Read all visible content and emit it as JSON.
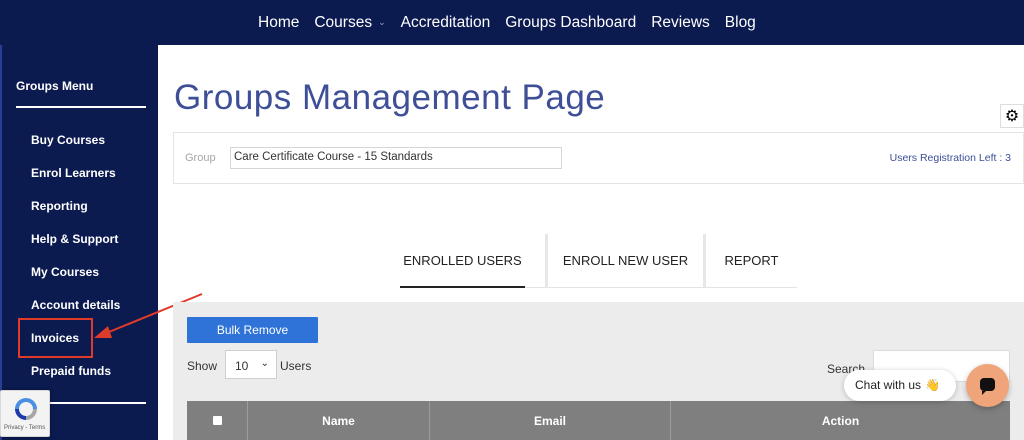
{
  "topnav": {
    "items": [
      {
        "label": "Home"
      },
      {
        "label": "Courses",
        "has_dropdown": true
      },
      {
        "label": "Accreditation"
      },
      {
        "label": "Groups Dashboard"
      },
      {
        "label": "Reviews"
      },
      {
        "label": "Blog"
      }
    ],
    "caret": "⌄"
  },
  "sidebar": {
    "title": "Groups Menu",
    "items": [
      {
        "label": "Buy Courses"
      },
      {
        "label": "Enrol Learners"
      },
      {
        "label": "Reporting"
      },
      {
        "label": "Help & Support"
      },
      {
        "label": "My Courses"
      },
      {
        "label": "Account details"
      },
      {
        "label": "Invoices",
        "highlighted": true
      },
      {
        "label": "Prepaid funds"
      }
    ],
    "highlight_color": "#e03a2a"
  },
  "recaptcha": {
    "terms": "Privacy - Terms"
  },
  "main": {
    "title": "Groups Management Page",
    "settings_icon": "gear-icon",
    "group": {
      "label": "Group",
      "selected": "Care Certificate Course - 15 Standards"
    },
    "registration_left": "Users Registration Left : 3",
    "tabs": [
      {
        "label": "ENROLLED USERS",
        "active": true
      },
      {
        "label": "ENROLL NEW USER",
        "active": false
      },
      {
        "label": "REPORT",
        "active": false
      }
    ],
    "bulk_remove": "Bulk Remove",
    "show_label": "Show",
    "page_size": "10",
    "users_label": "Users",
    "search_label": "Search",
    "table": {
      "columns": [
        "",
        "Name",
        "Email",
        "Action"
      ]
    }
  },
  "chat": {
    "label": "Chat with us",
    "emoji": "👋",
    "button_color": "#f0a47a"
  },
  "colors": {
    "navy": "#0b1a4f",
    "title_blue": "#3e4f97",
    "button_blue": "#2f73d8",
    "table_header": "#7f7f7f"
  }
}
